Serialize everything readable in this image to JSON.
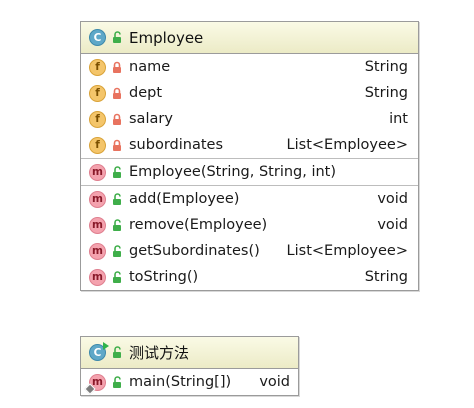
{
  "employee_class": {
    "kind_icon": "class-icon",
    "kind_letter": "C",
    "name": "Employee",
    "fields": [
      {
        "kind_letter": "f",
        "visibility": "private",
        "name": "name",
        "type": "String"
      },
      {
        "kind_letter": "f",
        "visibility": "private",
        "name": "dept",
        "type": "String"
      },
      {
        "kind_letter": "f",
        "visibility": "private",
        "name": "salary",
        "type": "int"
      },
      {
        "kind_letter": "f",
        "visibility": "private",
        "name": "subordinates",
        "type": "List<Employee>"
      }
    ],
    "constructors": [
      {
        "kind_letter": "m",
        "visibility": "public",
        "name": "Employee(String, String, int)",
        "type": ""
      }
    ],
    "methods": [
      {
        "kind_letter": "m",
        "visibility": "public",
        "name": "add(Employee)",
        "type": "void"
      },
      {
        "kind_letter": "m",
        "visibility": "public",
        "name": "remove(Employee)",
        "type": "void"
      },
      {
        "kind_letter": "m",
        "visibility": "public",
        "name": "getSubordinates()",
        "type": "List<Employee>"
      },
      {
        "kind_letter": "m",
        "visibility": "public",
        "name": "toString()",
        "type": "String"
      }
    ]
  },
  "test_class": {
    "kind_icon": "runnable-class-icon",
    "kind_letter": "C",
    "name": "测试方法",
    "methods": [
      {
        "kind_letter": "m",
        "visibility": "public",
        "static": true,
        "name": "main(String[])",
        "type": "void"
      }
    ]
  },
  "colors": {
    "header_gradient_top": "#fafae6",
    "header_gradient_bottom": "#ecebc6",
    "border": "#9b9b9b",
    "class_badge": "#5fa8c8",
    "field_badge": "#f4c56a",
    "method_badge": "#f4a2ae",
    "private_lock": "#e8735f",
    "public_lock": "#3fae4a"
  }
}
